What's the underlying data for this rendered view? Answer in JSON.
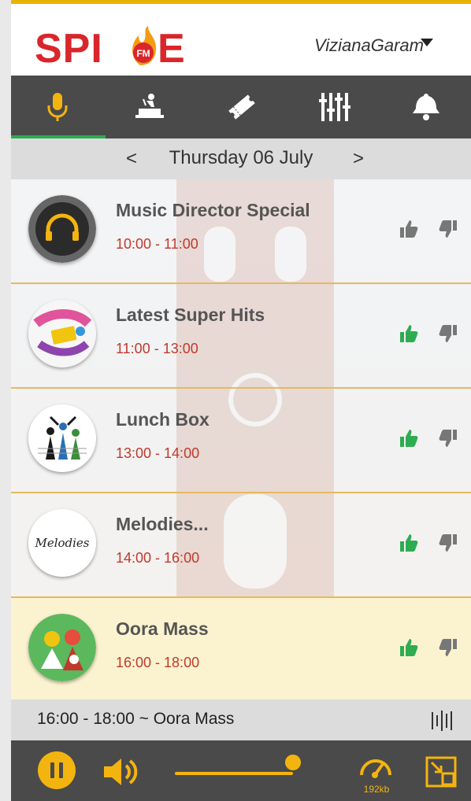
{
  "header": {
    "logo_text": "SPICE",
    "logo_fm": "FM",
    "city": "VizianaGaram"
  },
  "tabs": [
    {
      "name": "microphone-icon",
      "active": true
    },
    {
      "name": "dj-icon",
      "active": false
    },
    {
      "name": "ticket-icon",
      "active": false
    },
    {
      "name": "equalizer-icon",
      "active": false
    },
    {
      "name": "bell-icon",
      "active": false
    }
  ],
  "datebar": {
    "prev": "<",
    "label": "Thursday 06 July",
    "next": ">"
  },
  "shows": [
    {
      "title": "Music Director Special",
      "time": "10:00 - 11:00",
      "liked": false
    },
    {
      "title": "Latest Super Hits",
      "time": "11:00 - 13:00",
      "liked": true
    },
    {
      "title": "Lunch Box",
      "time": "13:00 - 14:00",
      "liked": true
    },
    {
      "title": "Melodies...",
      "time": "14:00 - 16:00",
      "liked": true,
      "logo_text": "Melodies"
    },
    {
      "title": "Oora Mass",
      "time": "16:00 - 18:00",
      "liked": true,
      "active": true
    }
  ],
  "now_playing": {
    "text": "16:00 - 18:00 ~ Oora Mass"
  },
  "player": {
    "bitrate": "192kb",
    "volume": 0.95
  },
  "colors": {
    "accent": "#f4b40f",
    "like": "#2eac52",
    "dislike": "#777777",
    "time": "#c0392b",
    "bar": "#4a4a4a"
  }
}
